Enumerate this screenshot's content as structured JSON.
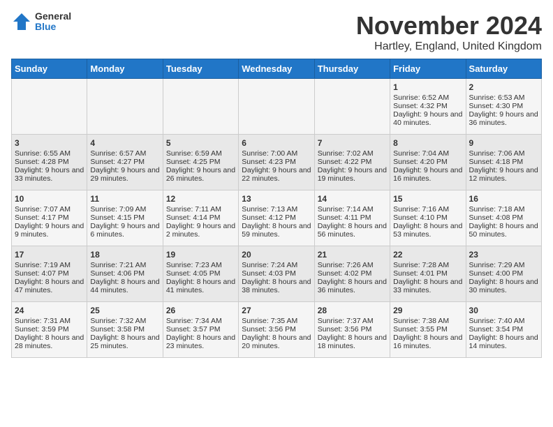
{
  "header": {
    "logo_general": "General",
    "logo_blue": "Blue",
    "month_title": "November 2024",
    "subtitle": "Hartley, England, United Kingdom"
  },
  "days_of_week": [
    "Sunday",
    "Monday",
    "Tuesday",
    "Wednesday",
    "Thursday",
    "Friday",
    "Saturday"
  ],
  "weeks": [
    [
      {
        "day": "",
        "content": ""
      },
      {
        "day": "",
        "content": ""
      },
      {
        "day": "",
        "content": ""
      },
      {
        "day": "",
        "content": ""
      },
      {
        "day": "",
        "content": ""
      },
      {
        "day": "1",
        "content": "Sunrise: 6:52 AM\nSunset: 4:32 PM\nDaylight: 9 hours and 40 minutes."
      },
      {
        "day": "2",
        "content": "Sunrise: 6:53 AM\nSunset: 4:30 PM\nDaylight: 9 hours and 36 minutes."
      }
    ],
    [
      {
        "day": "3",
        "content": "Sunrise: 6:55 AM\nSunset: 4:28 PM\nDaylight: 9 hours and 33 minutes."
      },
      {
        "day": "4",
        "content": "Sunrise: 6:57 AM\nSunset: 4:27 PM\nDaylight: 9 hours and 29 minutes."
      },
      {
        "day": "5",
        "content": "Sunrise: 6:59 AM\nSunset: 4:25 PM\nDaylight: 9 hours and 26 minutes."
      },
      {
        "day": "6",
        "content": "Sunrise: 7:00 AM\nSunset: 4:23 PM\nDaylight: 9 hours and 22 minutes."
      },
      {
        "day": "7",
        "content": "Sunrise: 7:02 AM\nSunset: 4:22 PM\nDaylight: 9 hours and 19 minutes."
      },
      {
        "day": "8",
        "content": "Sunrise: 7:04 AM\nSunset: 4:20 PM\nDaylight: 9 hours and 16 minutes."
      },
      {
        "day": "9",
        "content": "Sunrise: 7:06 AM\nSunset: 4:18 PM\nDaylight: 9 hours and 12 minutes."
      }
    ],
    [
      {
        "day": "10",
        "content": "Sunrise: 7:07 AM\nSunset: 4:17 PM\nDaylight: 9 hours and 9 minutes."
      },
      {
        "day": "11",
        "content": "Sunrise: 7:09 AM\nSunset: 4:15 PM\nDaylight: 9 hours and 6 minutes."
      },
      {
        "day": "12",
        "content": "Sunrise: 7:11 AM\nSunset: 4:14 PM\nDaylight: 9 hours and 2 minutes."
      },
      {
        "day": "13",
        "content": "Sunrise: 7:13 AM\nSunset: 4:12 PM\nDaylight: 8 hours and 59 minutes."
      },
      {
        "day": "14",
        "content": "Sunrise: 7:14 AM\nSunset: 4:11 PM\nDaylight: 8 hours and 56 minutes."
      },
      {
        "day": "15",
        "content": "Sunrise: 7:16 AM\nSunset: 4:10 PM\nDaylight: 8 hours and 53 minutes."
      },
      {
        "day": "16",
        "content": "Sunrise: 7:18 AM\nSunset: 4:08 PM\nDaylight: 8 hours and 50 minutes."
      }
    ],
    [
      {
        "day": "17",
        "content": "Sunrise: 7:19 AM\nSunset: 4:07 PM\nDaylight: 8 hours and 47 minutes."
      },
      {
        "day": "18",
        "content": "Sunrise: 7:21 AM\nSunset: 4:06 PM\nDaylight: 8 hours and 44 minutes."
      },
      {
        "day": "19",
        "content": "Sunrise: 7:23 AM\nSunset: 4:05 PM\nDaylight: 8 hours and 41 minutes."
      },
      {
        "day": "20",
        "content": "Sunrise: 7:24 AM\nSunset: 4:03 PM\nDaylight: 8 hours and 38 minutes."
      },
      {
        "day": "21",
        "content": "Sunrise: 7:26 AM\nSunset: 4:02 PM\nDaylight: 8 hours and 36 minutes."
      },
      {
        "day": "22",
        "content": "Sunrise: 7:28 AM\nSunset: 4:01 PM\nDaylight: 8 hours and 33 minutes."
      },
      {
        "day": "23",
        "content": "Sunrise: 7:29 AM\nSunset: 4:00 PM\nDaylight: 8 hours and 30 minutes."
      }
    ],
    [
      {
        "day": "24",
        "content": "Sunrise: 7:31 AM\nSunset: 3:59 PM\nDaylight: 8 hours and 28 minutes."
      },
      {
        "day": "25",
        "content": "Sunrise: 7:32 AM\nSunset: 3:58 PM\nDaylight: 8 hours and 25 minutes."
      },
      {
        "day": "26",
        "content": "Sunrise: 7:34 AM\nSunset: 3:57 PM\nDaylight: 8 hours and 23 minutes."
      },
      {
        "day": "27",
        "content": "Sunrise: 7:35 AM\nSunset: 3:56 PM\nDaylight: 8 hours and 20 minutes."
      },
      {
        "day": "28",
        "content": "Sunrise: 7:37 AM\nSunset: 3:56 PM\nDaylight: 8 hours and 18 minutes."
      },
      {
        "day": "29",
        "content": "Sunrise: 7:38 AM\nSunset: 3:55 PM\nDaylight: 8 hours and 16 minutes."
      },
      {
        "day": "30",
        "content": "Sunrise: 7:40 AM\nSunset: 3:54 PM\nDaylight: 8 hours and 14 minutes."
      }
    ]
  ]
}
